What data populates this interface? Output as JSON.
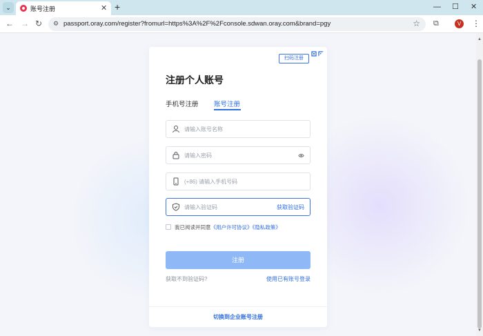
{
  "browser": {
    "tab_title": "账号注册",
    "url": "passport.oray.com/register?fromurl=https%3A%2F%2Fconsole.sdwan.oray.com&brand=pgy",
    "profile_initial": "V"
  },
  "form": {
    "qr_hint": "扫码注册",
    "title": "注册个人账号",
    "tabs": {
      "phone": "手机号注册",
      "account": "账号注册"
    },
    "account_placeholder": "请输入账号名称",
    "password_placeholder": "请输入密码",
    "phone_placeholder": "(+86) 请输入手机号码",
    "code_placeholder": "请输入验证码",
    "get_code": "获取验证码",
    "agree_prefix": "我已阅读并同意",
    "license_link": "《用户许可协议》",
    "privacy_link": "《隐私政策》",
    "submit": "注册",
    "no_code": "获取不到验证码?",
    "login_existing": "使用已有账号登录",
    "switch_enterprise": "切换到企业账号注册"
  },
  "colors": {
    "accent": "#2f6ee0",
    "submit_disabled": "#8fb8f7",
    "tabbar": "#cfe6ef"
  }
}
